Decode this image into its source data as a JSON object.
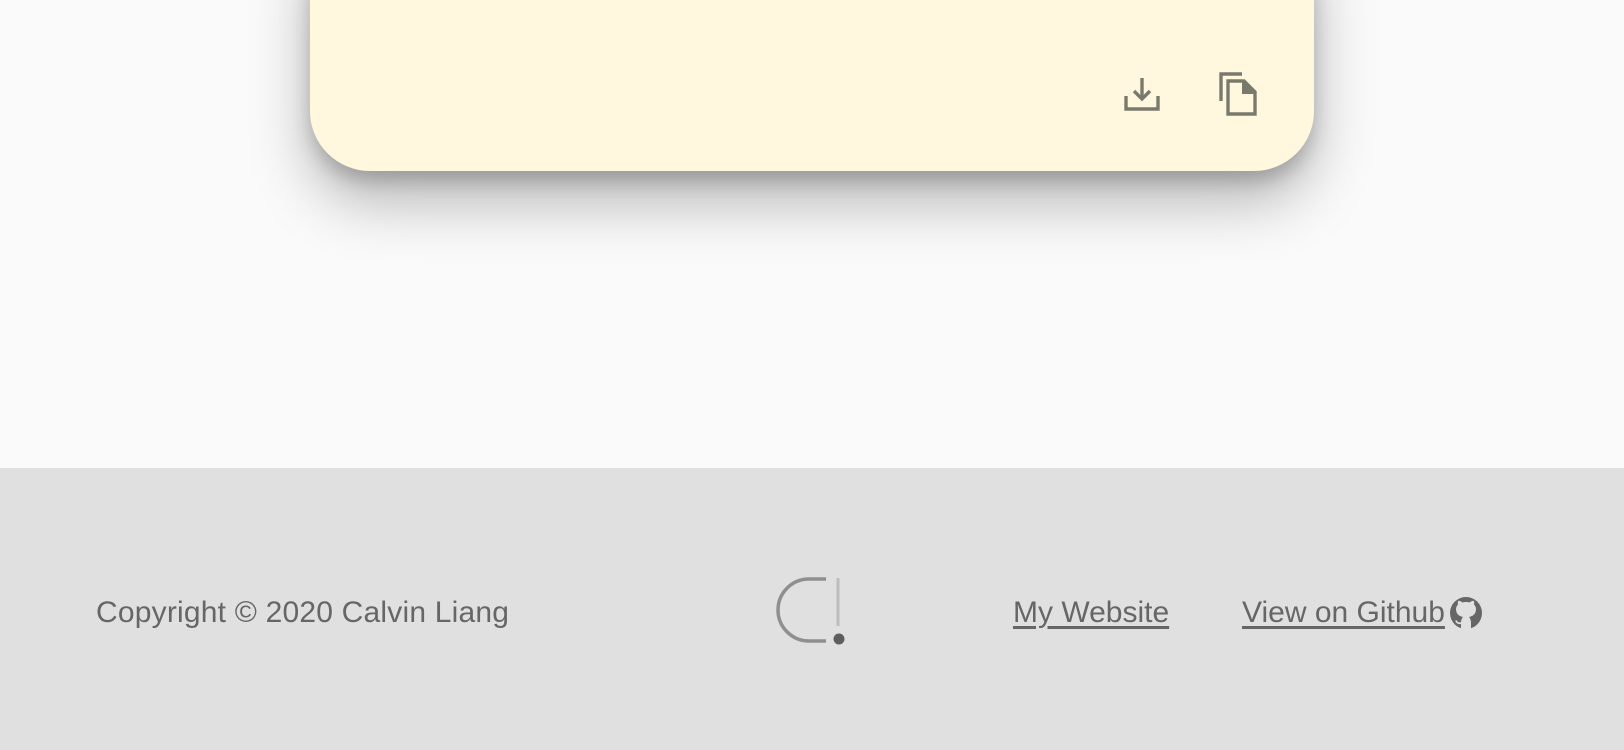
{
  "card": {
    "background": "#fff8de",
    "actions": [
      {
        "icon": "download-icon",
        "label": "Download"
      },
      {
        "icon": "copy-icon",
        "label": "Copy"
      }
    ]
  },
  "footer": {
    "copyright": "Copyright © 2020 Calvin Liang",
    "logo": "calvin-liang-logo",
    "links": {
      "website": "My Website",
      "github": "View on Github "
    },
    "text_color": "#666666",
    "background": "#e0e0e0"
  }
}
